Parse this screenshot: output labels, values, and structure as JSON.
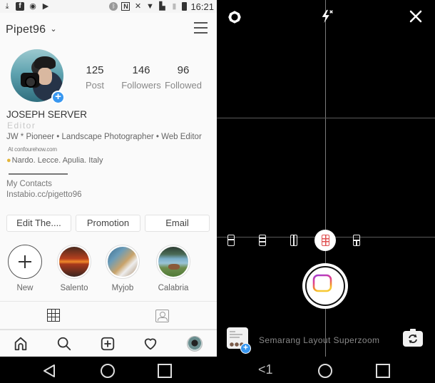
{
  "status_bar": {
    "left_icons": [
      "download-done-icon",
      "facebook-icon",
      "sync-icon",
      "play-store-icon"
    ],
    "right_icons": [
      "bluetooth-icon",
      "nfc-icon",
      "mute-icon",
      "wifi-icon",
      "sim-icon",
      "signal-icon",
      "battery-icon"
    ],
    "time": "16:21"
  },
  "instagram": {
    "username": "Pipet96",
    "username_chevron": "⌄",
    "stats": [
      {
        "value": "125",
        "label": "Post"
      },
      {
        "value": "146",
        "label": "Followers"
      },
      {
        "value": "96",
        "label": "Followed"
      }
    ],
    "bio": {
      "name": "JOSEPH SERVER",
      "category": "Editor",
      "description": "JW * Pioneer • Landscape Photographer • Web Editor",
      "link": "At confourehow.com",
      "location_pin": "●",
      "location": "Nardo. Lecce. Apulia. Italy",
      "contacts": "My Contacts",
      "contacts_link": "Instabio.cc/pigetto96"
    },
    "buttons": {
      "edit": "Edit The....",
      "promotion": "Promotion",
      "email": "Email"
    },
    "highlights": [
      {
        "label": "New"
      },
      {
        "label": "Salento"
      },
      {
        "label": "Myjob"
      },
      {
        "label": "Calabria"
      }
    ],
    "avatar_add": "+",
    "tabs": [
      "grid-icon",
      "tagged-icon"
    ],
    "bottom_nav": [
      "home-icon",
      "search-icon",
      "add-post-icon",
      "heart-icon",
      "profile-avatar"
    ]
  },
  "layout_camera": {
    "top_icons": [
      "settings-icon",
      "flash-off-icon",
      "close-icon"
    ],
    "layout_options": [
      "layout-2-rows",
      "layout-3-rows",
      "layout-2-columns",
      "layout-6-grid",
      "layout-1-top-2-bottom"
    ],
    "selected_layout_index": 3,
    "caption": "Semarang Layout Superzoom",
    "gallery_add": "+"
  },
  "android_nav": {
    "left": [
      "back-icon",
      "home-icon",
      "recents-icon"
    ],
    "right_back_label": "<1",
    "right": [
      "home-icon",
      "recents-icon"
    ]
  },
  "colors": {
    "accent_blue": "#3897f0",
    "selected_layout": "#e05050",
    "location_pin": "#e3b53a"
  }
}
